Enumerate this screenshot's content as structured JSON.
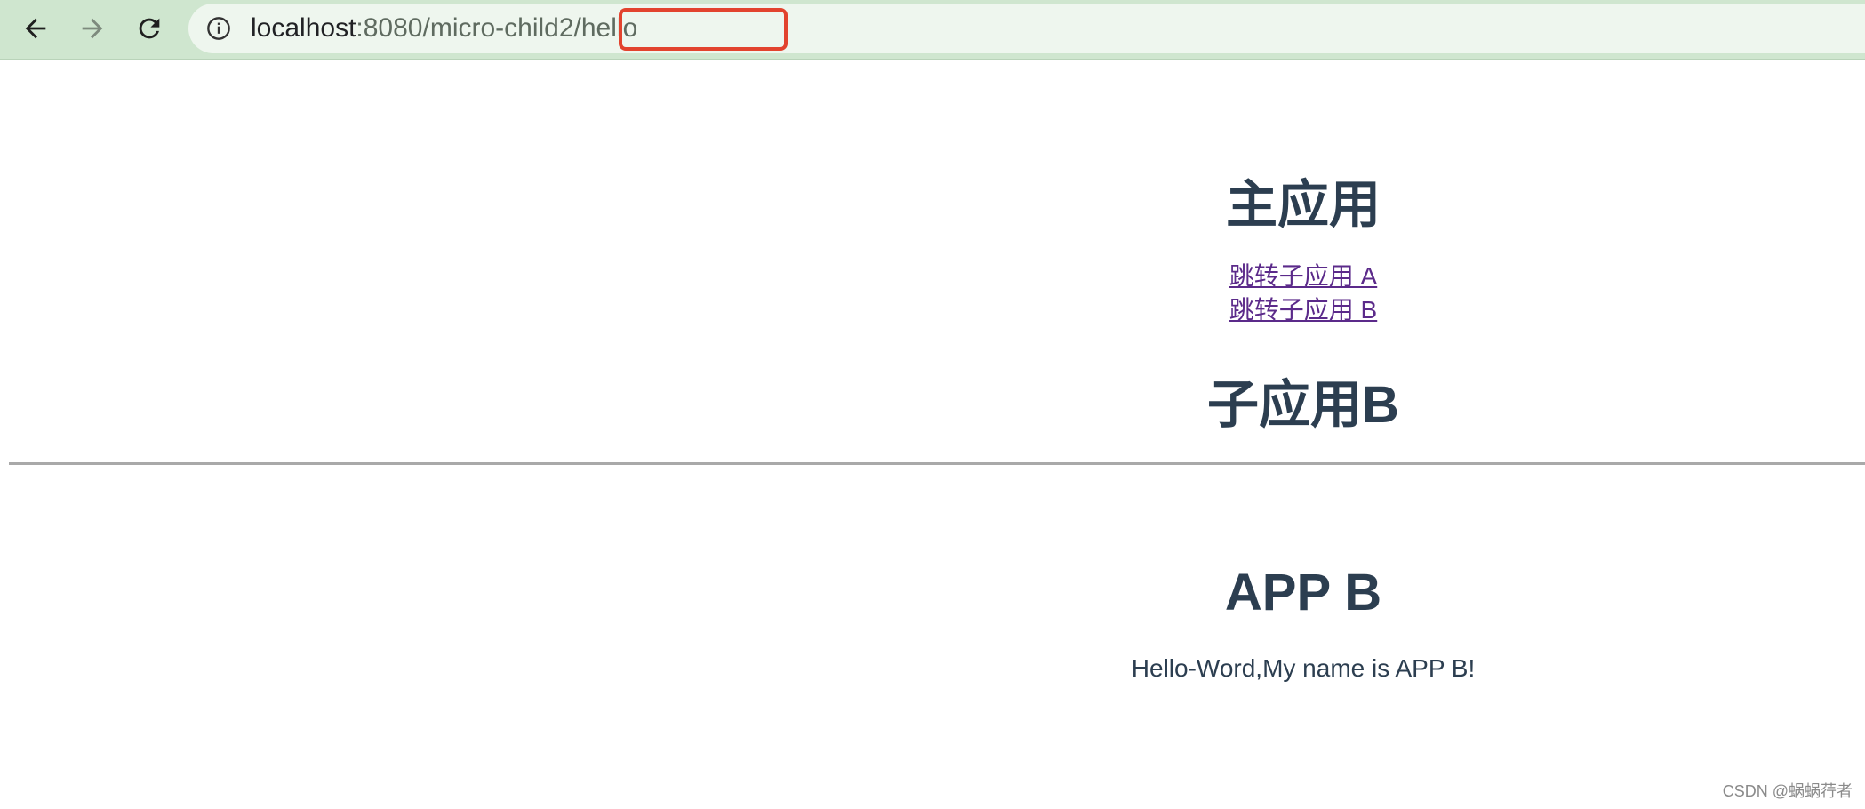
{
  "browser": {
    "address_bar": {
      "host": "localhost",
      "port_path_prefix": ":8080/",
      "highlighted_segment": "micro-child2/",
      "path_suffix": "hello"
    },
    "icons": {
      "back": "arrow-left-icon",
      "forward": "arrow-right-icon",
      "reload": "reload-icon",
      "info": "info-icon"
    },
    "colors": {
      "toolbar": "#cfe6cf",
      "omnibox": "#eef6ee",
      "highlight": "#e2432e"
    }
  },
  "page": {
    "main_title": "主应用",
    "links": [
      {
        "label": "跳转子应用 A"
      },
      {
        "label": "跳转子应用 B"
      }
    ],
    "child_title": "子应用B",
    "app_title": "APP B",
    "message": "Hello-Word,My name is APP B!"
  },
  "watermark": "CSDN @蜗蜗荇者"
}
